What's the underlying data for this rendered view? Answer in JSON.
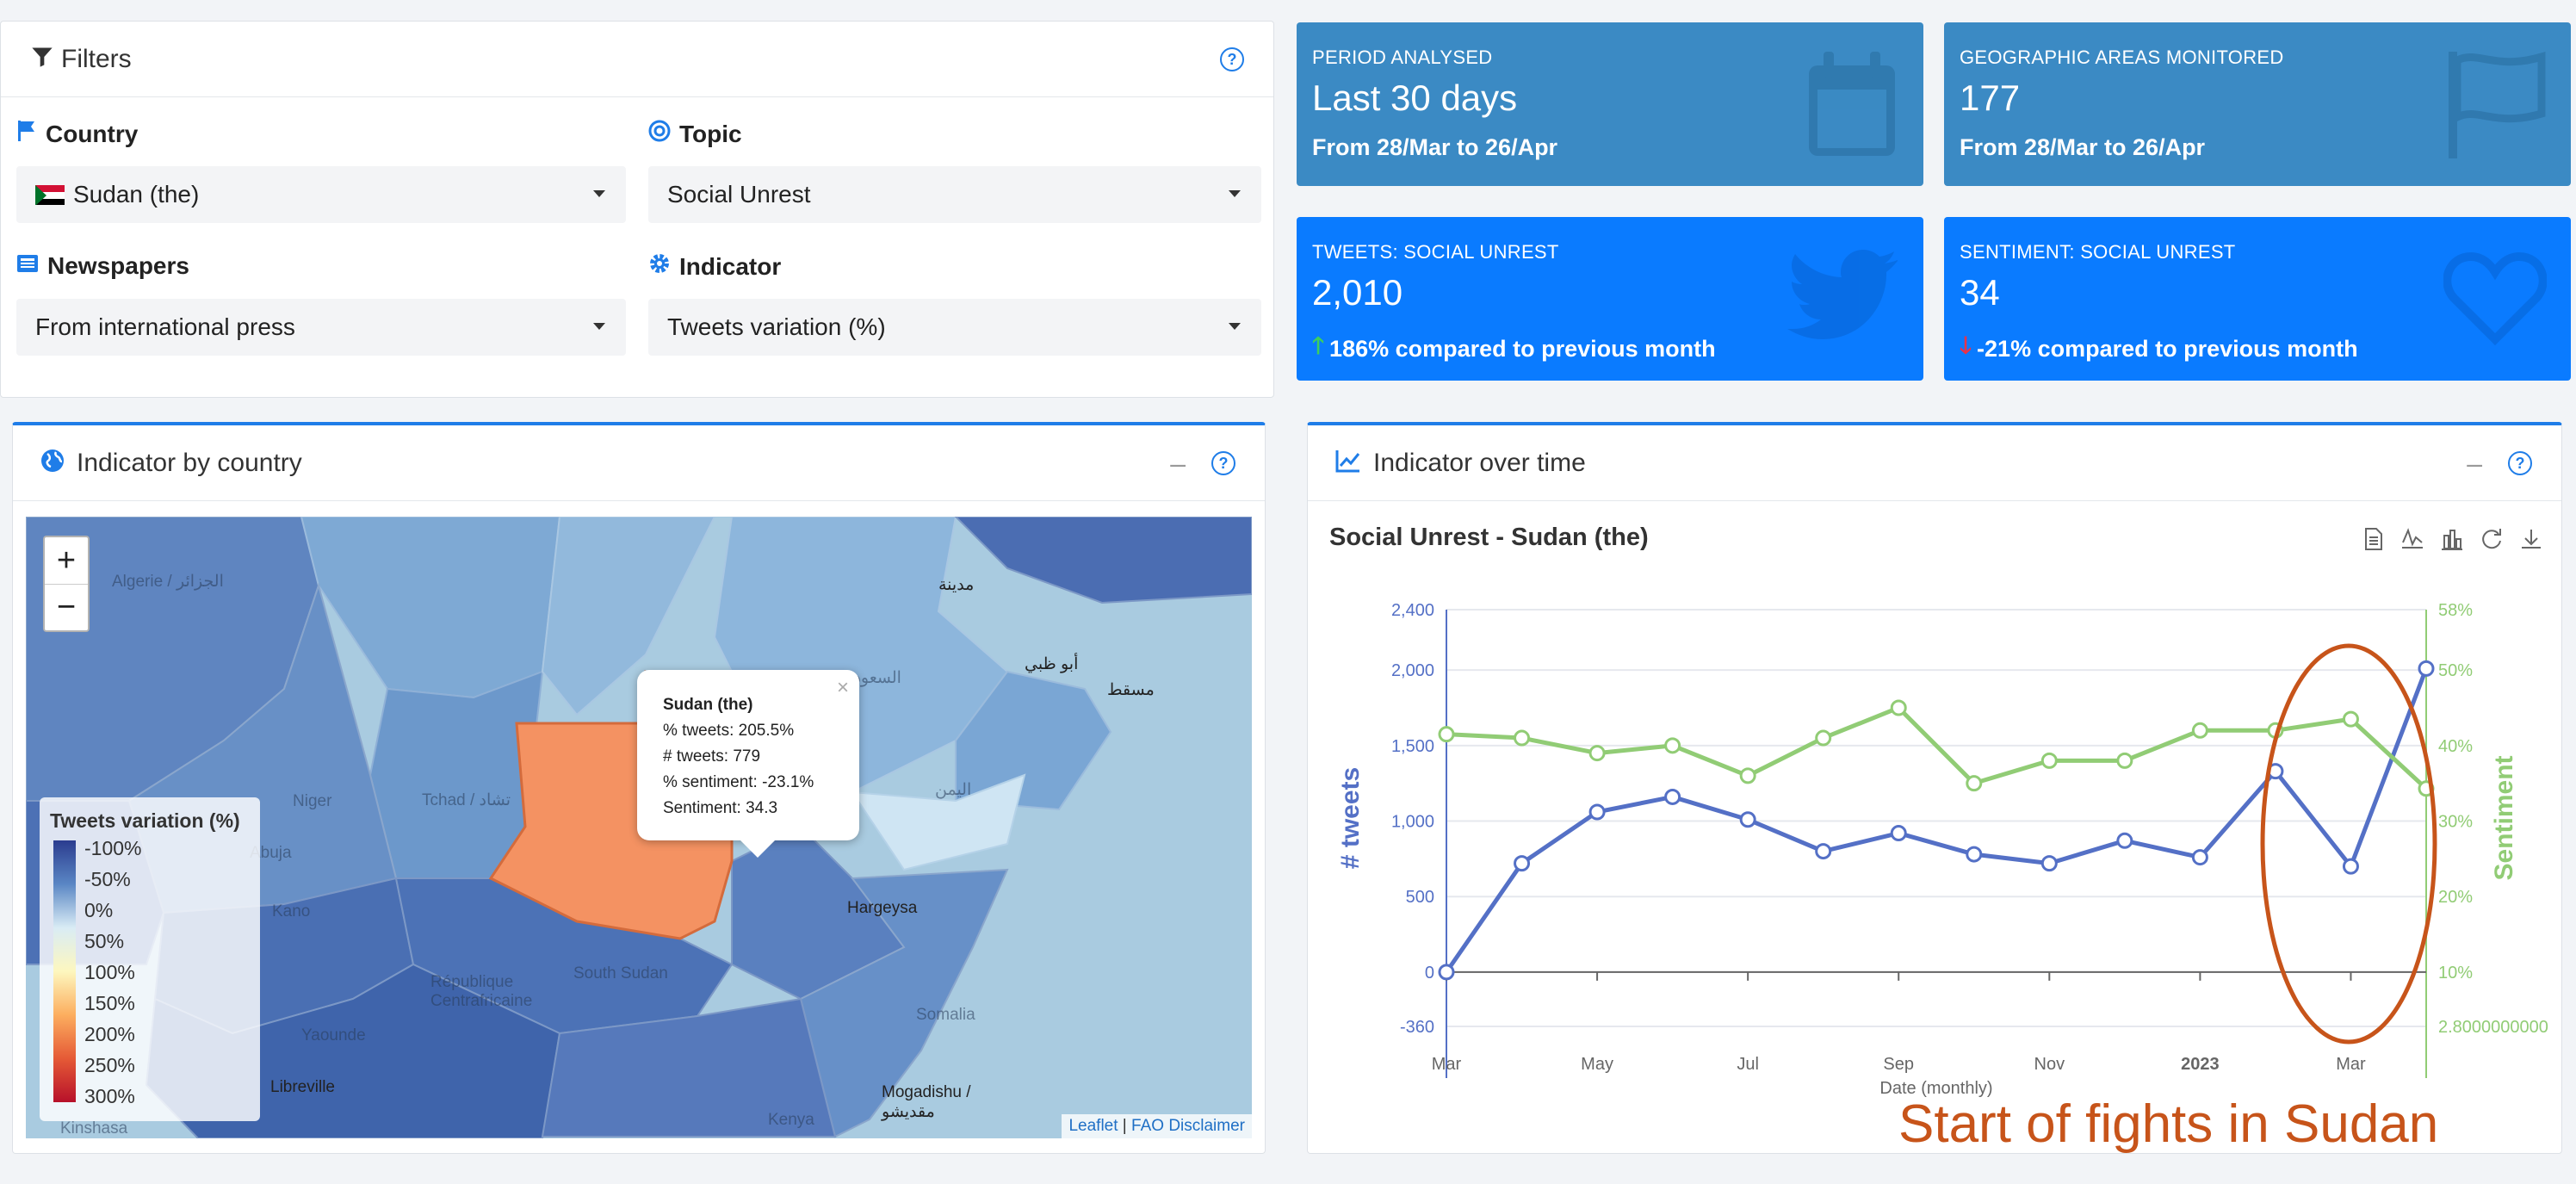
{
  "filters": {
    "title": "Filters",
    "help": "?",
    "country": {
      "label": "Country",
      "value": "Sudan (the)"
    },
    "topic": {
      "label": "Topic",
      "value": "Social Unrest"
    },
    "newspapers": {
      "label": "Newspapers",
      "value": "From international press"
    },
    "indicator": {
      "label": "Indicator",
      "value": "Tweets variation (%)"
    }
  },
  "kpis": [
    {
      "label": "PERIOD ANALYSED",
      "value": "Last 30 days",
      "sub": "From 28/Mar to 26/Apr",
      "color": "#3b8ac4",
      "icon": "calendar-icon"
    },
    {
      "label": "GEOGRAPHIC AREAS MONITORED",
      "value": "177",
      "sub": "From 28/Mar to 26/Apr",
      "color": "#3b8ac4",
      "icon": "flag-icon"
    },
    {
      "label": "TWEETS: SOCIAL UNREST",
      "value": "2,010",
      "sub": "186% compared to previous month",
      "color": "#0a7bff",
      "icon": "twitter-icon",
      "arrow": "up"
    },
    {
      "label": "SENTIMENT: SOCIAL UNREST",
      "value": "34",
      "sub": "-21% compared to previous month",
      "color": "#0a7bff",
      "icon": "heart-icon",
      "arrow": "down"
    }
  ],
  "map_panel": {
    "title": "Indicator by country",
    "minimize": "–",
    "help": "?",
    "zoom_in": "+",
    "zoom_out": "−",
    "legend": {
      "title": "Tweets variation (%)",
      "ticks": [
        "-100%",
        "-50%",
        "0%",
        "50%",
        "100%",
        "150%",
        "200%",
        "250%",
        "300%"
      ]
    },
    "popup": {
      "close": "×",
      "country": "Sudan (the)",
      "lines": [
        "% tweets: 205.5%",
        "# tweets: 779",
        "% sentiment: -23.1%",
        "Sentiment: 34.3"
      ]
    },
    "attribution": {
      "leaflet": "Leaflet",
      "sep": " | ",
      "disclaimer": "FAO Disclaimer"
    },
    "labels": [
      "Algerie / الجزائر",
      "Niger",
      "Tchad / تشاد",
      "South Sudan",
      "République Centrafricaine",
      "Yaounde",
      "Kano",
      "Libreville",
      "Mogadishu / مقديشو",
      "Kenya",
      "مسقط",
      "مدينة",
      "Somalia",
      "Hargeysa",
      "اليمن",
      "السعودية",
      "Kinshasa",
      "Abuja",
      "أبو ظبي"
    ]
  },
  "chart_panel": {
    "title": "Indicator over time",
    "minimize": "–",
    "help": "?"
  },
  "chart_data": {
    "type": "line",
    "title": "Social Unrest - Sudan (the)",
    "xlabel": "Date (monthly)",
    "ylabel_left": "# tweets",
    "ylabel_right": "Sentiment",
    "x": [
      "2022-03",
      "2022-04",
      "2022-05",
      "2022-06",
      "2022-07",
      "2022-08",
      "2022-09",
      "2022-10",
      "2022-11",
      "2022-12",
      "2023-01",
      "2023-02",
      "2023-03",
      "2023-04"
    ],
    "x_tick_labels": [
      "Mar",
      "May",
      "Jul",
      "Sep",
      "Nov",
      "2023",
      "Mar"
    ],
    "y_left_ticks": [
      "-360",
      "0",
      "500",
      "1,000",
      "1,500",
      "2,000",
      "2,400"
    ],
    "y_right_ticks": [
      "2.8000000000",
      "10%",
      "20%",
      "30%",
      "40%",
      "50%",
      "58%"
    ],
    "ylim_left": [
      -360,
      2400
    ],
    "ylim_right": [
      2.8,
      58
    ],
    "series": [
      {
        "name": "# tweets",
        "axis": "left",
        "color": "#5470c6",
        "values": [
          0,
          720,
          1060,
          1160,
          1010,
          800,
          920,
          780,
          720,
          870,
          760,
          1330,
          700,
          2010
        ]
      },
      {
        "name": "Sentiment",
        "axis": "right",
        "color": "#91cc75",
        "values": [
          41.5,
          41,
          39,
          40,
          36,
          41,
          45,
          35,
          38,
          38,
          42,
          42,
          43.5,
          34.3
        ]
      }
    ],
    "grid": true,
    "annotation_color": "#c7541a"
  },
  "annotation": {
    "text": "Start of fights in Sudan",
    "color": "#c7541a"
  }
}
